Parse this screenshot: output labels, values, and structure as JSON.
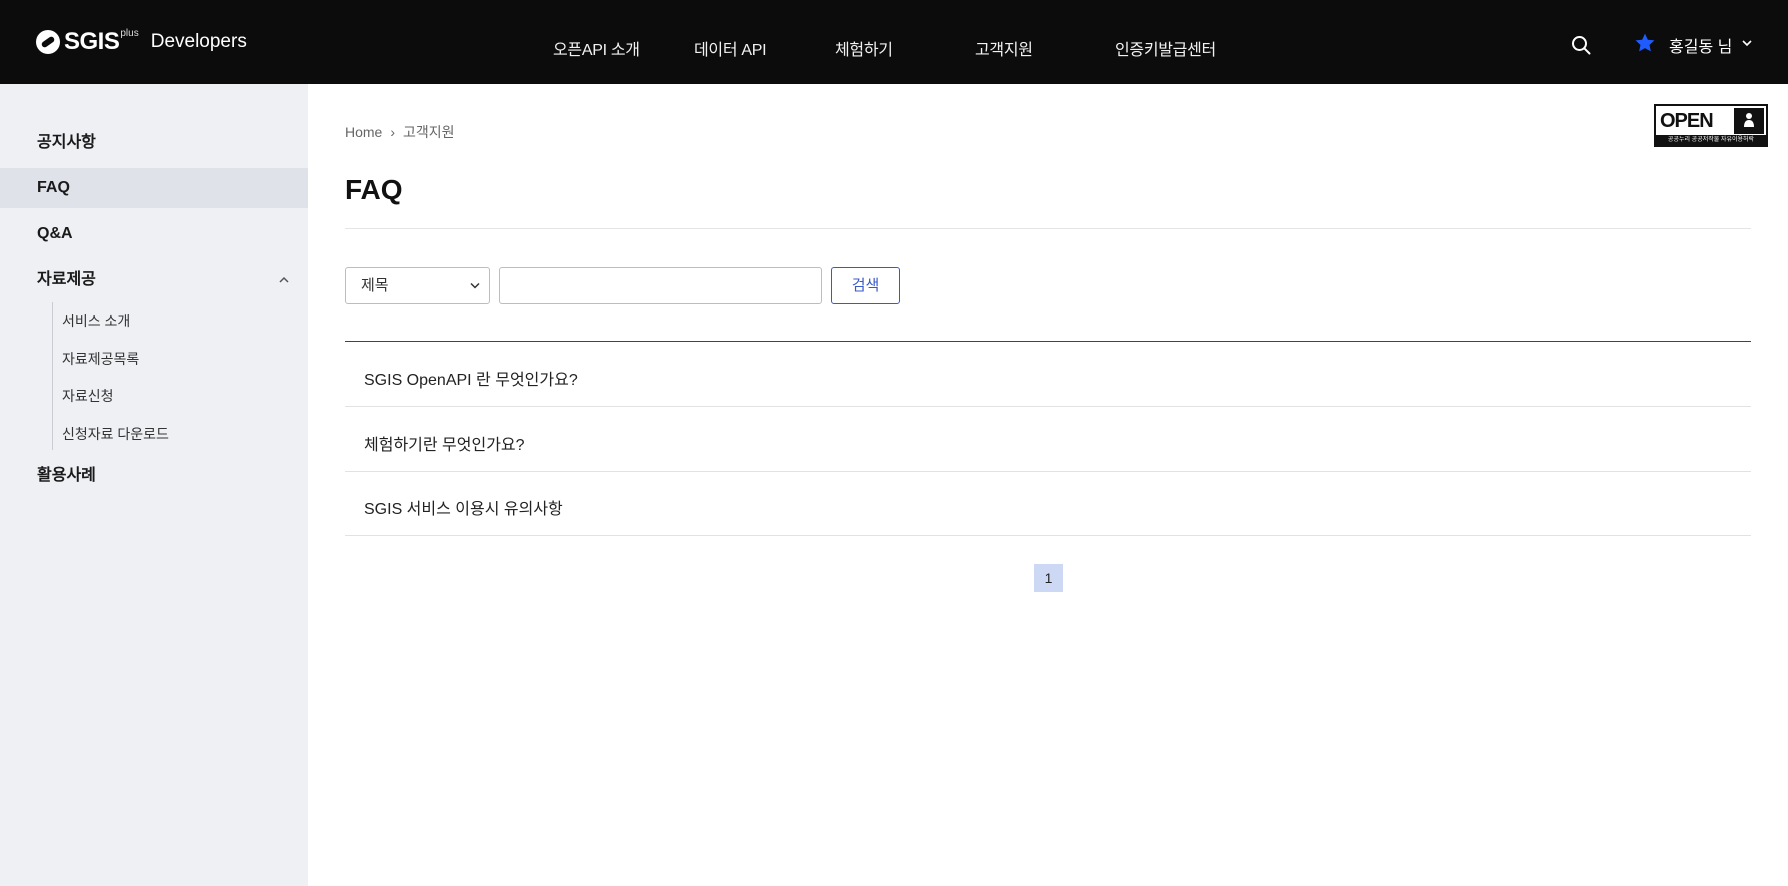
{
  "header": {
    "logo_text": "SGIS",
    "logo_sup": "plus",
    "logo_suffix": "Developers",
    "nav": [
      "오픈API 소개",
      "데이터 API",
      "체험하기",
      "고객지원",
      "인증키발급센터"
    ],
    "user_name": "홍길동 님",
    "icons": {
      "search": "search-icon",
      "star": "star-icon",
      "caret": "chevron-down-icon"
    },
    "star_color": "#1f5cff"
  },
  "sidebar": {
    "items": [
      {
        "label": "공지사항"
      },
      {
        "label": "FAQ",
        "active": true
      },
      {
        "label": "Q&A"
      },
      {
        "label": "자료제공",
        "expanded": true
      },
      {
        "label": "활용사례"
      }
    ],
    "sub_items": [
      "서비스 소개",
      "자료제공목록",
      "자료신청",
      "신청자료 다운로드"
    ]
  },
  "breadcrumb": {
    "home": "Home",
    "sep": "›",
    "current": "고객지원"
  },
  "badge": {
    "word": "OPEN",
    "caption": "공공누리  공공저작물 자유이용허락"
  },
  "page": {
    "title": "FAQ"
  },
  "search": {
    "select_value": "제목",
    "input_value": "",
    "button_label": "검색"
  },
  "faq": {
    "questions": [
      "SGIS OpenAPI 란 무엇인가요?",
      "체험하기란 무엇인가요?",
      "SGIS 서비스 이용시 유의사항"
    ]
  },
  "pagination": {
    "current_page": "1"
  },
  "colors": {
    "accent": "#3a59c8",
    "header_bg": "#0c0c0c",
    "sidebar_bg": "#eef0f4",
    "pager_bg": "#cdd8f4"
  }
}
